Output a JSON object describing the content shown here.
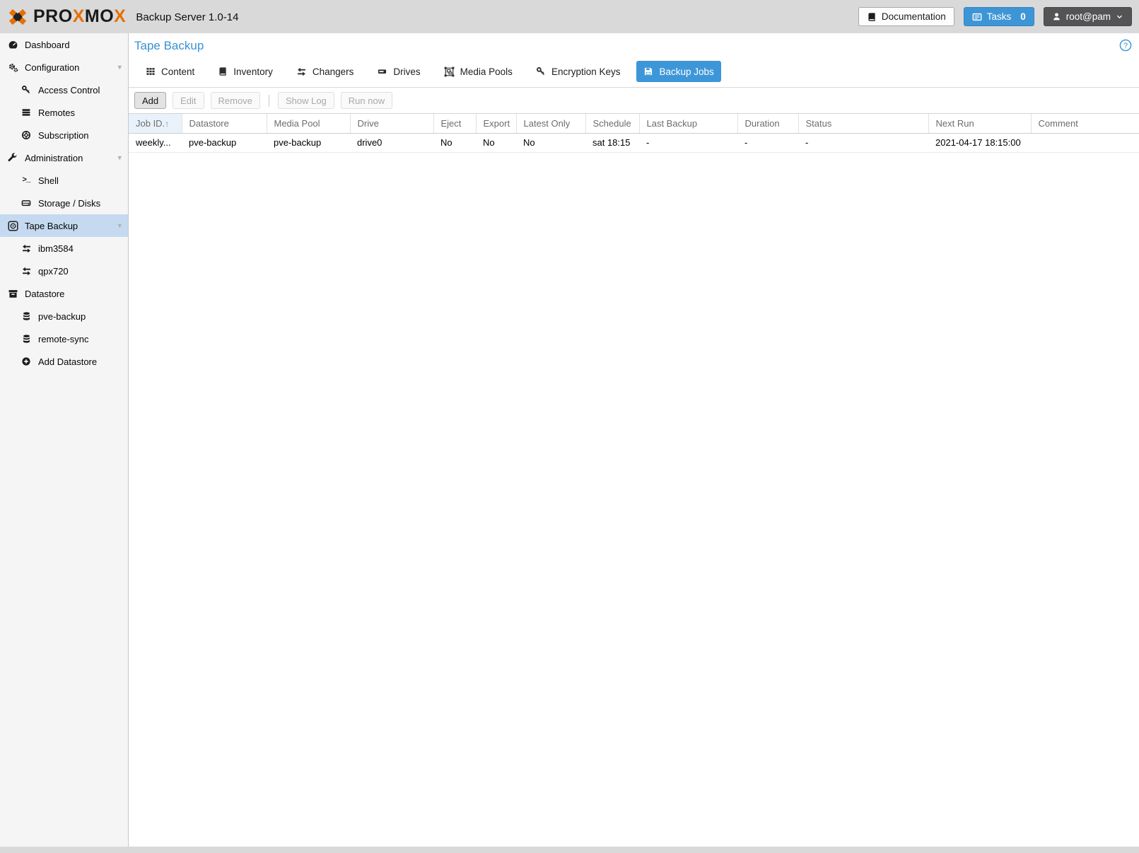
{
  "app": {
    "brand": [
      "PRO",
      "X",
      "MO",
      "X"
    ],
    "title": "Backup Server 1.0-14"
  },
  "topbar": {
    "documentation_label": "Documentation",
    "tasks_label": "Tasks",
    "tasks_count": "0",
    "user_label": "root@pam"
  },
  "sidebar": {
    "items": [
      {
        "label": "Dashboard",
        "icon": "dashboard-icon",
        "level": 0,
        "selected": false,
        "expandable": false
      },
      {
        "label": "Configuration",
        "icon": "gears-icon",
        "level": 0,
        "selected": false,
        "expandable": true
      },
      {
        "label": "Access Control",
        "icon": "key-icon",
        "level": 1,
        "selected": false,
        "expandable": false
      },
      {
        "label": "Remotes",
        "icon": "server-list-icon",
        "level": 1,
        "selected": false,
        "expandable": false
      },
      {
        "label": "Subscription",
        "icon": "life-ring-icon",
        "level": 1,
        "selected": false,
        "expandable": false
      },
      {
        "label": "Administration",
        "icon": "wrench-icon",
        "level": 0,
        "selected": false,
        "expandable": true
      },
      {
        "label": "Shell",
        "icon": "terminal-icon",
        "level": 1,
        "selected": false,
        "expandable": false
      },
      {
        "label": "Storage / Disks",
        "icon": "hdd-icon",
        "level": 1,
        "selected": false,
        "expandable": false
      },
      {
        "label": "Tape Backup",
        "icon": "tape-icon",
        "level": 0,
        "selected": true,
        "expandable": true
      },
      {
        "label": "ibm3584",
        "icon": "exchange-icon",
        "level": 1,
        "selected": false,
        "expandable": false
      },
      {
        "label": "qpx720",
        "icon": "exchange-icon",
        "level": 1,
        "selected": false,
        "expandable": false
      },
      {
        "label": "Datastore",
        "icon": "archive-icon",
        "level": 0,
        "selected": false,
        "expandable": false
      },
      {
        "label": "pve-backup",
        "icon": "database-icon",
        "level": 1,
        "selected": false,
        "expandable": false
      },
      {
        "label": "remote-sync",
        "icon": "database-icon",
        "level": 1,
        "selected": false,
        "expandable": false
      },
      {
        "label": "Add Datastore",
        "icon": "plus-circle-icon",
        "level": 1,
        "selected": false,
        "expandable": false
      }
    ]
  },
  "content": {
    "title": "Tape Backup",
    "tabs": [
      {
        "label": "Content",
        "icon": "grid-icon",
        "active": false
      },
      {
        "label": "Inventory",
        "icon": "book-icon",
        "active": false
      },
      {
        "label": "Changers",
        "icon": "exchange-icon",
        "active": false
      },
      {
        "label": "Drives",
        "icon": "drive-icon",
        "active": false
      },
      {
        "label": "Media Pools",
        "icon": "object-group-icon",
        "active": false
      },
      {
        "label": "Encryption Keys",
        "icon": "key-icon",
        "active": false
      },
      {
        "label": "Backup Jobs",
        "icon": "floppy-icon",
        "active": true
      }
    ],
    "toolbar": {
      "buttons": [
        {
          "label": "Add",
          "disabled": false
        },
        {
          "label": "Edit",
          "disabled": true
        },
        {
          "label": "Remove",
          "disabled": true
        },
        {
          "label": "Show Log",
          "disabled": true
        },
        {
          "label": "Run now",
          "disabled": true
        }
      ]
    },
    "table": {
      "columns": [
        "Job ID.",
        "Datastore",
        "Media Pool",
        "Drive",
        "Eject",
        "Export",
        "Latest Only",
        "Schedule",
        "Last Backup",
        "Duration",
        "Status",
        "Next Run",
        "Comment"
      ],
      "sort_indicator": "↑",
      "sorted_column": "Job ID.",
      "rows": [
        [
          "weekly...",
          "pve-backup",
          "pve-backup",
          "drive0",
          "No",
          "No",
          "No",
          "sat 18:15",
          "-",
          "-",
          "-",
          "2021-04-17 18:15:00",
          ""
        ]
      ]
    }
  },
  "icons": {
    "proxmox-logo": "crossed X mark, orange tips with dark center",
    "book-icon": "book",
    "tasks-list-icon": "panel with list lines",
    "user-icon": "person silhouette",
    "chevron-down-icon": "▾",
    "dashboard-icon": "gauge with needle",
    "gears-icon": "two gears",
    "key-icon": "key",
    "server-list-icon": "three stacked bars",
    "life-ring-icon": "life ring",
    "wrench-icon": "wrench",
    "terminal-icon": ">_",
    "hdd-icon": "disk drive tray",
    "tape-icon": "tape cartridge with reel",
    "exchange-icon": "two opposite horizontal arrows",
    "archive-icon": "archive box with slot",
    "database-icon": "database cylinder",
    "plus-circle-icon": "circle with plus",
    "grid-icon": "3x3 grid of squares",
    "object-group-icon": "grouped objects with corner handles",
    "floppy-icon": "floppy disk",
    "help-circle-icon": "circled question mark",
    "sort-asc-icon": "↑"
  },
  "colors": {
    "accent_blue": "#3892d4",
    "brand_orange": "#e57000",
    "topbar_bg": "#d9d9d9",
    "sidebar_bg": "#f5f5f5",
    "sidebar_selected_bg": "#c5daf0",
    "active_tab_bg": "#3d96d8",
    "tasks_button_bg": "#3e95d5",
    "user_button_bg": "#545456",
    "sorted_header_bg": "#e9f2fb"
  }
}
